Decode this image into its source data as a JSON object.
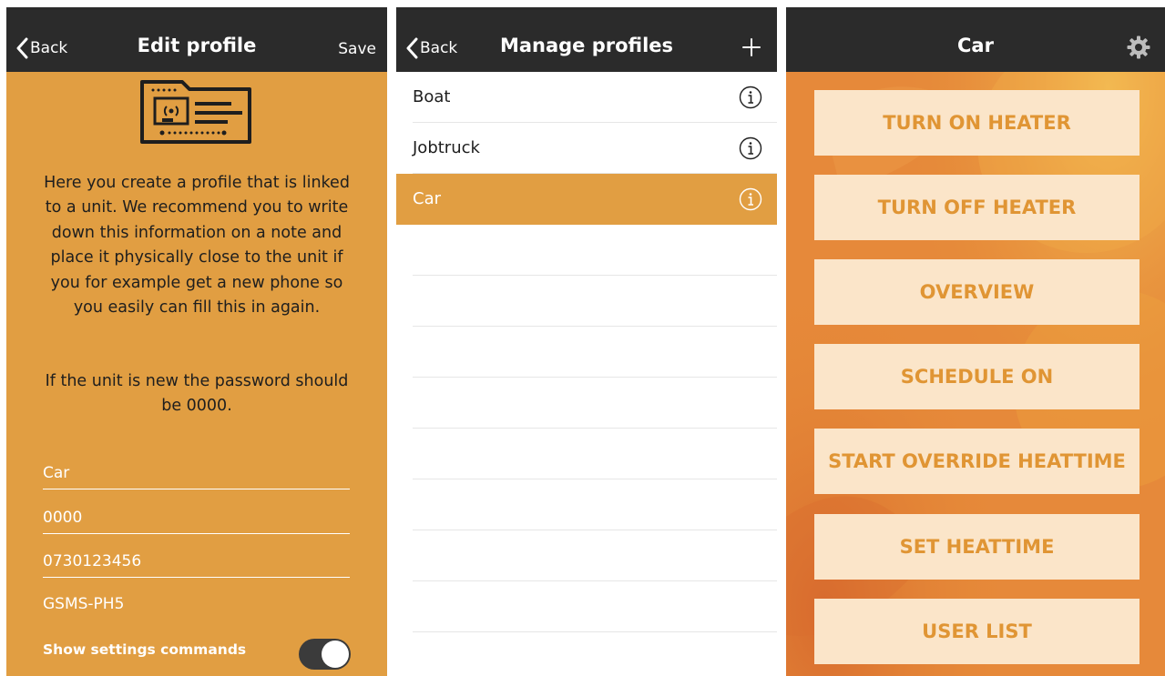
{
  "edit_profile": {
    "back_label": "Back",
    "title": "Edit profile",
    "save_label": "Save",
    "icon": "sim-card-icon",
    "description": "Here you create a profile that is linked to a unit. We recommend you to write down this information on a note and place it physically close to the unit if you for example get a new phone so you easily can fill this in again.",
    "password_note": "If the unit is new the password should be 0000.",
    "fields": {
      "profile_name": "Car",
      "password": "0000",
      "phone_number": "0730123456"
    },
    "device_model": "GSMS-PH5",
    "settings_toggle": {
      "label": "Show settings commands",
      "on": true
    }
  },
  "manage_profiles": {
    "back_label": "Back",
    "title": "Manage profiles",
    "add_icon": "plus-icon",
    "profiles": [
      {
        "name": "Boat",
        "selected": false
      },
      {
        "name": "Jobtruck",
        "selected": false
      },
      {
        "name": "Car",
        "selected": true
      }
    ],
    "empty_rows": 8
  },
  "car": {
    "title": "Car",
    "settings_icon": "gear-icon",
    "commands": [
      "TURN ON HEATER",
      "TURN OFF HEATER",
      "OVERVIEW",
      "SCHEDULE ON",
      "START OVERRIDE HEATTIME",
      "SET HEATTIME",
      "USER LIST"
    ]
  },
  "colors": {
    "accent": "#e19e42",
    "navbar": "#2b2b2b",
    "button_bg": "#fbe5c9",
    "button_text": "#e09534"
  }
}
